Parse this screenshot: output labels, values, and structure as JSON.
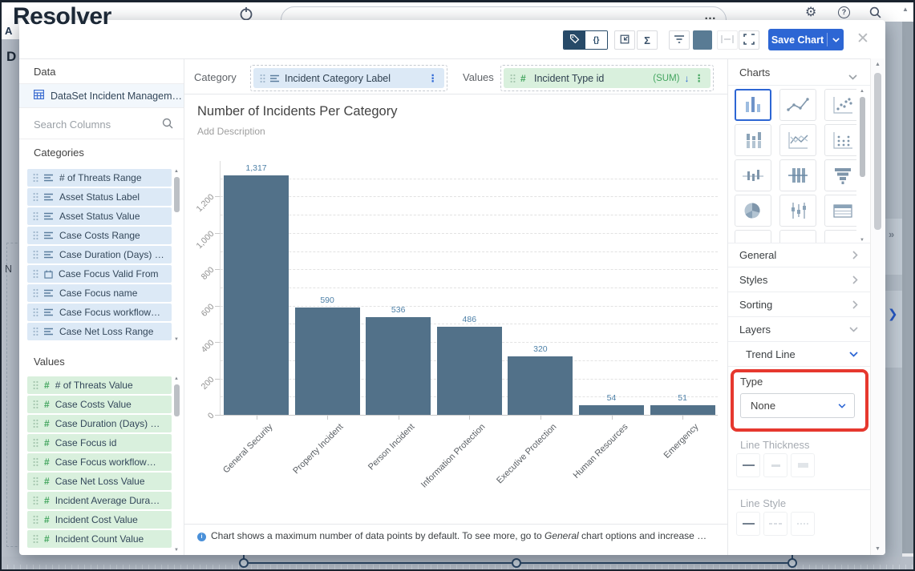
{
  "app": {
    "logo": "Resolver",
    "left_letters": [
      "A",
      "D",
      "N"
    ]
  },
  "icons": {
    "braces": "{}",
    "sum": "Σ",
    "close": "✕",
    "more": "…",
    "gear": "⚙",
    "help": "?",
    "scroll_up": "▲",
    "scroll_down": "▼",
    "collapse": "»",
    "forward": "❯",
    "hash": "#",
    "kebab": "⋮",
    "arrow_down": "↓"
  },
  "toolbar": {
    "save_chart": "Save Chart",
    "swatch_color": "#597b94"
  },
  "builder": {
    "category_label": "Category",
    "category_field": "Incident Category Label",
    "values_label": "Values",
    "values_field": "Incident Type id",
    "values_aggregation": "(SUM)"
  },
  "sidebar": {
    "header": "Data",
    "dataset": "DataSet Incident Managem…",
    "search_placeholder": "Search Columns",
    "categories_header": "Categories",
    "categories": [
      {
        "label": "# of Threats Range",
        "icon": "list"
      },
      {
        "label": "Asset Status Label",
        "icon": "list"
      },
      {
        "label": "Asset Status Value",
        "icon": "list"
      },
      {
        "label": "Case Costs Range",
        "icon": "list"
      },
      {
        "label": "Case Duration (Days) …",
        "icon": "list"
      },
      {
        "label": "Case Focus Valid From",
        "icon": "calendar"
      },
      {
        "label": "Case Focus name",
        "icon": "list"
      },
      {
        "label": "Case Focus workflow…",
        "icon": "list"
      },
      {
        "label": "Case Net Loss Range",
        "icon": "list"
      }
    ],
    "values_header": "Values",
    "values": [
      {
        "label": "# of Threats Value",
        "icon": "hash"
      },
      {
        "label": "Case Costs Value",
        "icon": "hash"
      },
      {
        "label": "Case Duration (Days) …",
        "icon": "hash"
      },
      {
        "label": "Case Focus id",
        "icon": "hash"
      },
      {
        "label": "Case Focus workflow…",
        "icon": "hash"
      },
      {
        "label": "Case Net Loss Value",
        "icon": "hash"
      },
      {
        "label": "Incident Average Dura…",
        "icon": "hash"
      },
      {
        "label": "Incident Cost Value",
        "icon": "hash"
      },
      {
        "label": "Incident Count Value",
        "icon": "hash"
      }
    ]
  },
  "chart_data": {
    "type": "bar",
    "title": "Number of Incidents Per Category",
    "subtitle_placeholder": "Add Description",
    "categories": [
      "General Security",
      "Property Incident",
      "Person Incident",
      "Information Protection",
      "Executive Protection",
      "Human Resources",
      "Emergency"
    ],
    "values": [
      1317,
      590,
      536,
      486,
      320,
      54,
      51
    ],
    "value_labels": [
      "1,317",
      "590",
      "536",
      "486",
      "320",
      "54",
      "51"
    ],
    "yticks": [
      0,
      200,
      400,
      600,
      800,
      1000,
      1200
    ],
    "ytick_labels": [
      "0",
      "200",
      "400",
      "600",
      "800",
      "1,000",
      "1,200"
    ],
    "ylim": [
      0,
      1400
    ],
    "xlabel": "",
    "ylabel": "",
    "grid": "dashed horizontal every 100",
    "legend": "none",
    "bar_color": "#527189"
  },
  "note": {
    "prefix": "Chart shows a maximum number of data points by default. To see more, go to ",
    "italic": "General",
    "suffix": " chart options and increase …"
  },
  "right_panel": {
    "charts_header": "Charts",
    "chart_types": [
      {
        "name": "bar",
        "selected": true
      },
      {
        "name": "line",
        "selected": false
      },
      {
        "name": "scatter",
        "selected": false
      },
      {
        "name": "stacked-bar",
        "selected": false
      },
      {
        "name": "multi-line",
        "selected": false
      },
      {
        "name": "dot-column",
        "selected": false
      },
      {
        "name": "bar-line-small",
        "selected": false
      },
      {
        "name": "column-line",
        "selected": false
      },
      {
        "name": "funnel",
        "selected": false
      },
      {
        "name": "pie",
        "selected": false
      },
      {
        "name": "boxplot",
        "selected": false
      },
      {
        "name": "table",
        "selected": false
      }
    ],
    "sections": [
      {
        "label": "General",
        "chevron": "right"
      },
      {
        "label": "Styles",
        "chevron": "right"
      },
      {
        "label": "Sorting",
        "chevron": "right"
      },
      {
        "label": "Layers",
        "chevron": "down"
      }
    ],
    "trend_line_label": "Trend Line",
    "type_label": "Type",
    "type_value": "None",
    "line_thickness_label": "Line Thickness",
    "line_style_label": "Line Style"
  },
  "colors": {
    "accent": "#2d66d4",
    "bar": "#527189",
    "highlight": "#e6382e",
    "green": "#43a55f"
  }
}
